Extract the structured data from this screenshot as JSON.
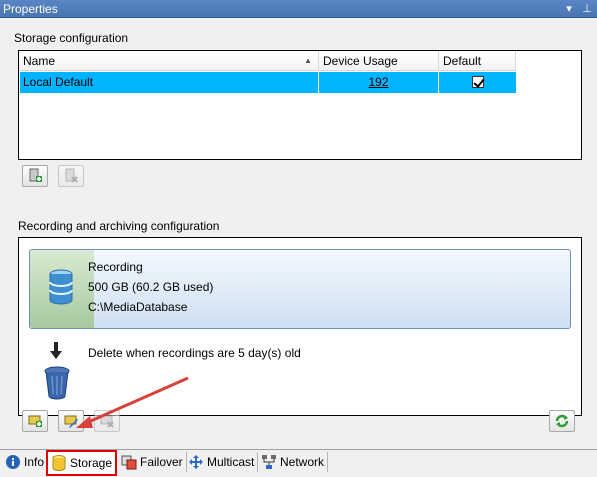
{
  "window": {
    "title": "Properties",
    "controls": [
      "▾",
      "⊥"
    ]
  },
  "storage": {
    "group_label": "Storage configuration",
    "columns": [
      "Name",
      "Device Usage",
      "Default"
    ],
    "rows": [
      {
        "name": "Local Default",
        "device_usage": "192",
        "default": true,
        "selected": true
      }
    ],
    "buttons": {
      "add_storage": "add-storage-icon",
      "remove_storage": "remove-storage-icon"
    }
  },
  "recording": {
    "group_label": "Recording and archiving configuration",
    "card": {
      "title": "Recording",
      "size": "500 GB (60.2 GB used)",
      "path": "C:\\MediaDatabase"
    },
    "delete_text": "Delete when recordings are 5 day(s) old",
    "used_fraction": 0.12
  },
  "tabs": [
    {
      "label": "Info",
      "icon": "info-icon",
      "active": false
    },
    {
      "label": "Storage",
      "icon": "database-icon",
      "active": true
    },
    {
      "label": "Failover",
      "icon": "failover-icon",
      "active": false
    },
    {
      "label": "Multicast",
      "icon": "multicast-icon",
      "active": false
    },
    {
      "label": "Network",
      "icon": "network-icon",
      "active": false
    }
  ],
  "colors": {
    "selection": "#00b4ff",
    "titlebar": "#4f7cbd",
    "highlight_box": "#e00000",
    "annotation_arrow": "#d9403a"
  }
}
